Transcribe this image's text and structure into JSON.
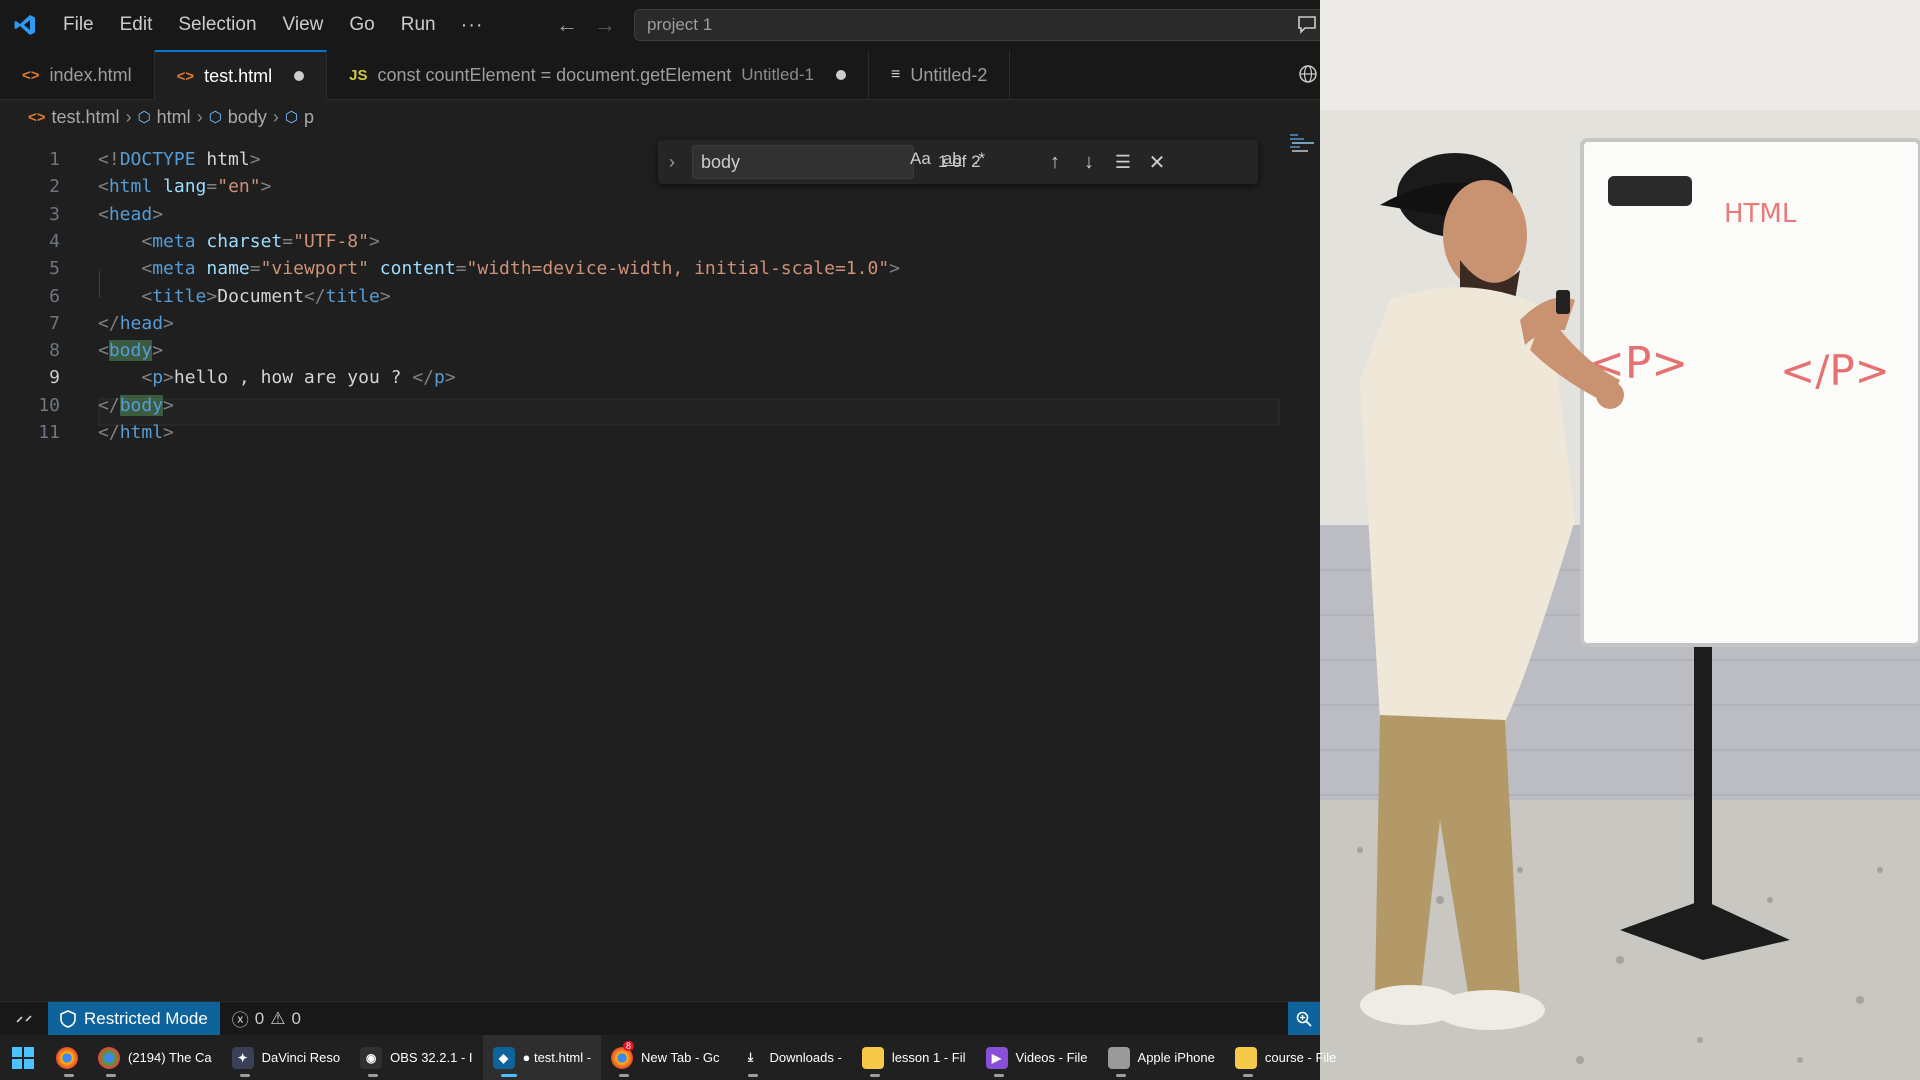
{
  "titlebar": {
    "menu": [
      "File",
      "Edit",
      "Selection",
      "View",
      "Go",
      "Run"
    ],
    "more": "···",
    "search_text": "project 1"
  },
  "tabs": [
    {
      "label": "index.html",
      "icon": "html-file-icon",
      "active": false,
      "modified": false
    },
    {
      "label": "test.html",
      "icon": "html-file-icon",
      "active": true,
      "modified": true
    },
    {
      "label": "const countElement = document.getElement",
      "sub": "Untitled-1",
      "icon": "js-file-icon",
      "active": false,
      "modified": true
    },
    {
      "label": "Untitled-2",
      "icon": "text-file-icon",
      "active": false,
      "modified": false
    }
  ],
  "breadcrumb": [
    "test.html",
    "html",
    "body",
    "p"
  ],
  "find": {
    "query": "body",
    "opt_case": "Aa",
    "opt_word": "ab",
    "opt_regex": ".*",
    "count": "1 of 2"
  },
  "editor": {
    "line_numbers": [
      "1",
      "2",
      "3",
      "4",
      "5",
      "6",
      "7",
      "8",
      "9",
      "10",
      "11"
    ],
    "current_line": 9,
    "lines": [
      "<!DOCTYPE html>",
      "<html lang=\"en\">",
      "<head>",
      "    <meta charset=\"UTF-8\">",
      "    <meta name=\"viewport\" content=\"width=device-width, initial-scale=1.0\">",
      "    <title>Document</title>",
      "</head>",
      "<body>",
      "    <p>hello , how are you ? </p>",
      "</body>",
      "</html>"
    ]
  },
  "statusbar": {
    "restricted": "Restricted Mode",
    "errors": "0",
    "warnings": "0"
  },
  "taskbar": [
    {
      "label": "",
      "icon": "chrome-icon"
    },
    {
      "label": "(2194) The Ca",
      "icon": "chrome-profile-icon"
    },
    {
      "label": "DaVinci Reso",
      "icon": "davinci-resolve-icon"
    },
    {
      "label": "OBS 32.2.1 - I",
      "icon": "obs-icon"
    },
    {
      "label": "● test.html -",
      "icon": "vscode-icon",
      "active": true
    },
    {
      "label": "New Tab - Gc",
      "icon": "chrome-icon",
      "badge": "8"
    },
    {
      "label": "Downloads -",
      "icon": "download-icon"
    },
    {
      "label": "lesson 1 - Fil",
      "icon": "folder-icon"
    },
    {
      "label": "Videos - File",
      "icon": "video-folder-icon"
    },
    {
      "label": "Apple iPhone",
      "icon": "phone-icon"
    },
    {
      "label": "course - File",
      "icon": "folder-icon"
    }
  ],
  "whiteboard": {
    "title": "HTML",
    "open_tag": "<P>",
    "close_tag": "</P>"
  },
  "colors": {
    "accent": "#0078d4",
    "restricted_bg": "#0e639c",
    "tag": "#569cd6",
    "attr": "#9cdcfe",
    "string": "#ce9178"
  }
}
